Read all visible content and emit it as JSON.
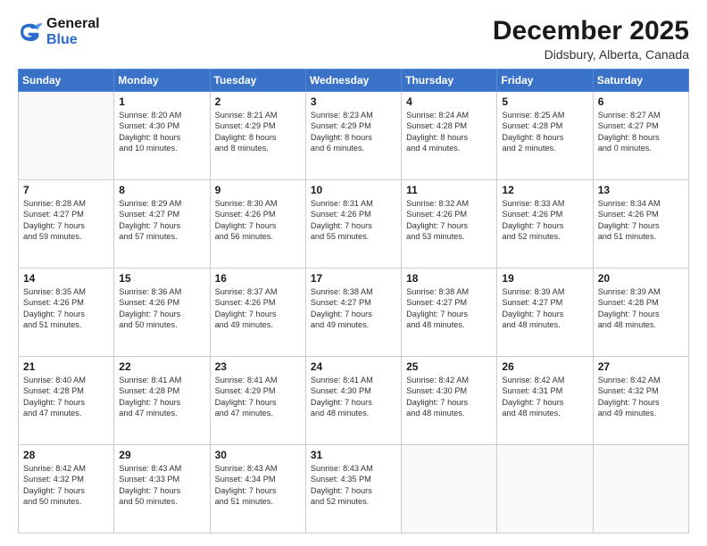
{
  "logo": {
    "line1": "General",
    "line2": "Blue"
  },
  "header": {
    "month": "December 2025",
    "location": "Didsbury, Alberta, Canada"
  },
  "weekdays": [
    "Sunday",
    "Monday",
    "Tuesday",
    "Wednesday",
    "Thursday",
    "Friday",
    "Saturday"
  ],
  "weeks": [
    [
      {
        "day": "",
        "content": ""
      },
      {
        "day": "1",
        "content": "Sunrise: 8:20 AM\nSunset: 4:30 PM\nDaylight: 8 hours\nand 10 minutes."
      },
      {
        "day": "2",
        "content": "Sunrise: 8:21 AM\nSunset: 4:29 PM\nDaylight: 8 hours\nand 8 minutes."
      },
      {
        "day": "3",
        "content": "Sunrise: 8:23 AM\nSunset: 4:29 PM\nDaylight: 8 hours\nand 6 minutes."
      },
      {
        "day": "4",
        "content": "Sunrise: 8:24 AM\nSunset: 4:28 PM\nDaylight: 8 hours\nand 4 minutes."
      },
      {
        "day": "5",
        "content": "Sunrise: 8:25 AM\nSunset: 4:28 PM\nDaylight: 8 hours\nand 2 minutes."
      },
      {
        "day": "6",
        "content": "Sunrise: 8:27 AM\nSunset: 4:27 PM\nDaylight: 8 hours\nand 0 minutes."
      }
    ],
    [
      {
        "day": "7",
        "content": "Sunrise: 8:28 AM\nSunset: 4:27 PM\nDaylight: 7 hours\nand 59 minutes."
      },
      {
        "day": "8",
        "content": "Sunrise: 8:29 AM\nSunset: 4:27 PM\nDaylight: 7 hours\nand 57 minutes."
      },
      {
        "day": "9",
        "content": "Sunrise: 8:30 AM\nSunset: 4:26 PM\nDaylight: 7 hours\nand 56 minutes."
      },
      {
        "day": "10",
        "content": "Sunrise: 8:31 AM\nSunset: 4:26 PM\nDaylight: 7 hours\nand 55 minutes."
      },
      {
        "day": "11",
        "content": "Sunrise: 8:32 AM\nSunset: 4:26 PM\nDaylight: 7 hours\nand 53 minutes."
      },
      {
        "day": "12",
        "content": "Sunrise: 8:33 AM\nSunset: 4:26 PM\nDaylight: 7 hours\nand 52 minutes."
      },
      {
        "day": "13",
        "content": "Sunrise: 8:34 AM\nSunset: 4:26 PM\nDaylight: 7 hours\nand 51 minutes."
      }
    ],
    [
      {
        "day": "14",
        "content": "Sunrise: 8:35 AM\nSunset: 4:26 PM\nDaylight: 7 hours\nand 51 minutes."
      },
      {
        "day": "15",
        "content": "Sunrise: 8:36 AM\nSunset: 4:26 PM\nDaylight: 7 hours\nand 50 minutes."
      },
      {
        "day": "16",
        "content": "Sunrise: 8:37 AM\nSunset: 4:26 PM\nDaylight: 7 hours\nand 49 minutes."
      },
      {
        "day": "17",
        "content": "Sunrise: 8:38 AM\nSunset: 4:27 PM\nDaylight: 7 hours\nand 49 minutes."
      },
      {
        "day": "18",
        "content": "Sunrise: 8:38 AM\nSunset: 4:27 PM\nDaylight: 7 hours\nand 48 minutes."
      },
      {
        "day": "19",
        "content": "Sunrise: 8:39 AM\nSunset: 4:27 PM\nDaylight: 7 hours\nand 48 minutes."
      },
      {
        "day": "20",
        "content": "Sunrise: 8:39 AM\nSunset: 4:28 PM\nDaylight: 7 hours\nand 48 minutes."
      }
    ],
    [
      {
        "day": "21",
        "content": "Sunrise: 8:40 AM\nSunset: 4:28 PM\nDaylight: 7 hours\nand 47 minutes."
      },
      {
        "day": "22",
        "content": "Sunrise: 8:41 AM\nSunset: 4:28 PM\nDaylight: 7 hours\nand 47 minutes."
      },
      {
        "day": "23",
        "content": "Sunrise: 8:41 AM\nSunset: 4:29 PM\nDaylight: 7 hours\nand 47 minutes."
      },
      {
        "day": "24",
        "content": "Sunrise: 8:41 AM\nSunset: 4:30 PM\nDaylight: 7 hours\nand 48 minutes."
      },
      {
        "day": "25",
        "content": "Sunrise: 8:42 AM\nSunset: 4:30 PM\nDaylight: 7 hours\nand 48 minutes."
      },
      {
        "day": "26",
        "content": "Sunrise: 8:42 AM\nSunset: 4:31 PM\nDaylight: 7 hours\nand 48 minutes."
      },
      {
        "day": "27",
        "content": "Sunrise: 8:42 AM\nSunset: 4:32 PM\nDaylight: 7 hours\nand 49 minutes."
      }
    ],
    [
      {
        "day": "28",
        "content": "Sunrise: 8:42 AM\nSunset: 4:32 PM\nDaylight: 7 hours\nand 50 minutes."
      },
      {
        "day": "29",
        "content": "Sunrise: 8:43 AM\nSunset: 4:33 PM\nDaylight: 7 hours\nand 50 minutes."
      },
      {
        "day": "30",
        "content": "Sunrise: 8:43 AM\nSunset: 4:34 PM\nDaylight: 7 hours\nand 51 minutes."
      },
      {
        "day": "31",
        "content": "Sunrise: 8:43 AM\nSunset: 4:35 PM\nDaylight: 7 hours\nand 52 minutes."
      },
      {
        "day": "",
        "content": ""
      },
      {
        "day": "",
        "content": ""
      },
      {
        "day": "",
        "content": ""
      }
    ]
  ]
}
